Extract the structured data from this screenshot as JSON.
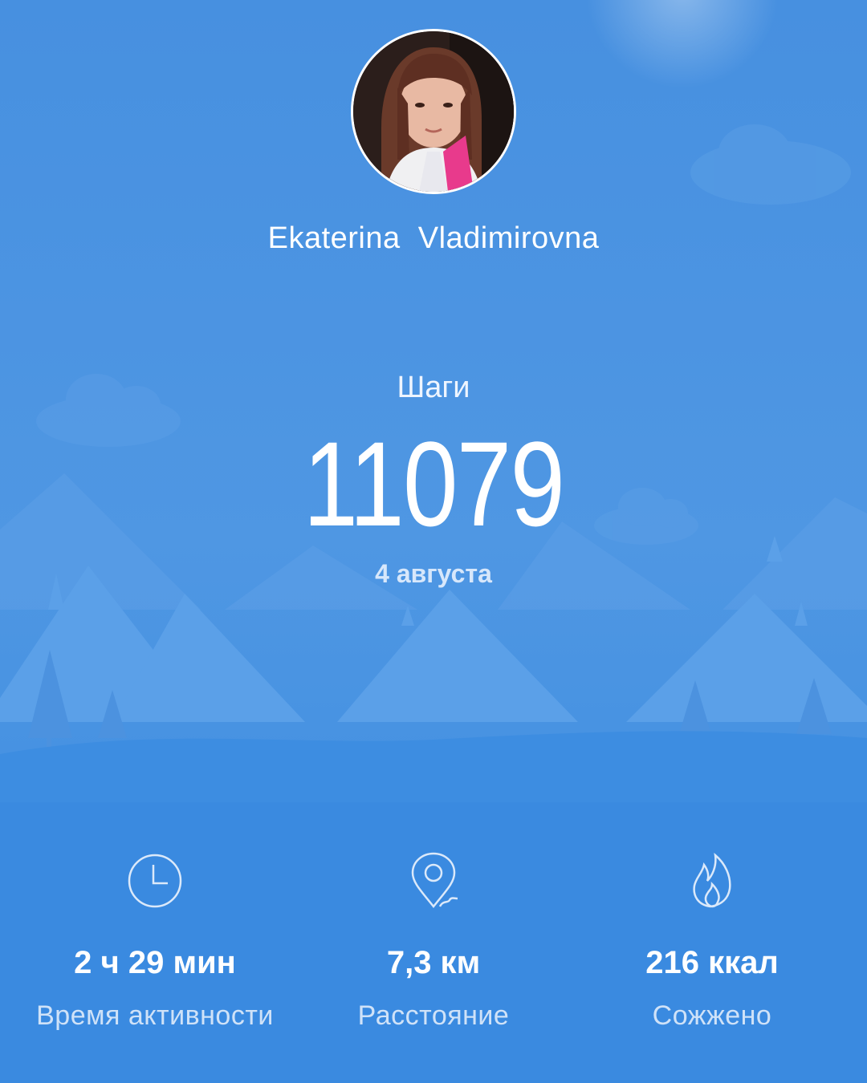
{
  "profile": {
    "name": "Ekaterina  Vladimirovna"
  },
  "steps": {
    "label": "Шаги",
    "value": "11079",
    "date": "4 августа"
  },
  "stats": [
    {
      "icon": "clock-icon",
      "value": "2 ч 29 мин",
      "label": "Время активности"
    },
    {
      "icon": "location-pin-icon",
      "value": "7,3 км",
      "label": "Расстояние"
    },
    {
      "icon": "flame-icon",
      "value": "216 ккал",
      "label": "Сожжено"
    }
  ],
  "colors": {
    "sky": "#4a92e0",
    "ground": "#3f8ee2",
    "text": "#ffffff"
  }
}
